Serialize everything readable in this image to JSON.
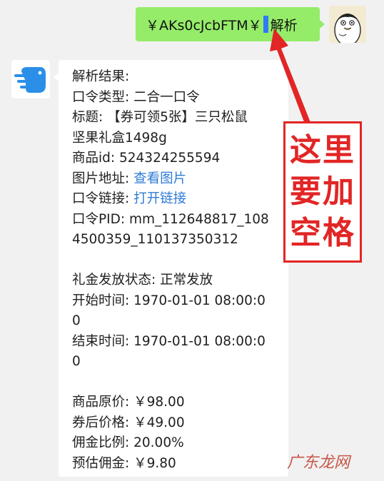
{
  "sent_message": {
    "token_text": "￥AKs0cJcbFTM￥",
    "command_text": "解析"
  },
  "reply": {
    "lines": [
      {
        "label": "解析结果:",
        "value": ""
      },
      {
        "label": "口令类型: ",
        "value": "二合一口令"
      },
      {
        "label": "标题: ",
        "value": "【券可领5张】三只松鼠"
      },
      {
        "label": "",
        "value": "坚果礼盒1498g"
      },
      {
        "label": "商品id: ",
        "value": "524324255594"
      },
      {
        "label": "图片地址: ",
        "link": "查看图片"
      },
      {
        "label": "口令链接: ",
        "link": "打开链接"
      },
      {
        "label": "口令PID: ",
        "value": "mm_112648817_108"
      },
      {
        "label": "",
        "value": "4500359_110137350312"
      },
      {
        "blank": true
      },
      {
        "label": "礼金发放状态: ",
        "value": "正常发放"
      },
      {
        "label": "开始时间: ",
        "value": "1970-01-01 08:00:0"
      },
      {
        "label": "",
        "value": "0"
      },
      {
        "label": "结束时间: ",
        "value": "1970-01-01 08:00:0"
      },
      {
        "label": "",
        "value": "0"
      },
      {
        "blank": true
      },
      {
        "label": "商品原价: ",
        "value": "￥98.00"
      },
      {
        "label": "券后价格: ",
        "value": "￥49.00"
      },
      {
        "label": "佣金比例: ",
        "value": "20.00%"
      },
      {
        "label": "预估佣金: ",
        "value": "￥9.80"
      }
    ]
  },
  "annotation": {
    "lines": [
      "这里",
      "要加",
      "空格"
    ],
    "color": "#e22525"
  },
  "watermark": "广东龙网",
  "colors": {
    "sent_bubble": "#95ec69",
    "link": "#2f7bd6",
    "cursor": "#2f7bf6",
    "bot_avatar": "#2b8fe8"
  }
}
